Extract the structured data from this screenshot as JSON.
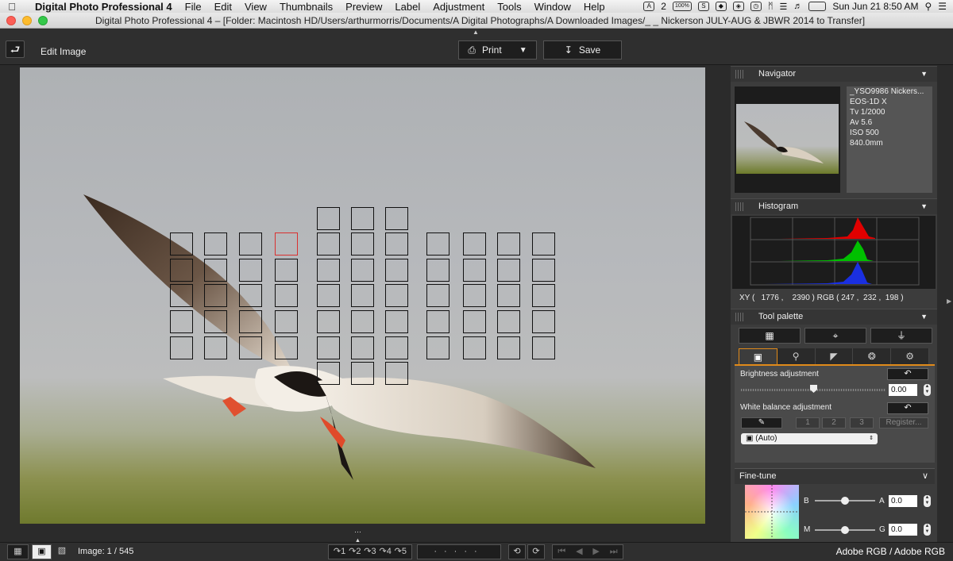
{
  "menubar": {
    "app_name": "Digital Photo Professional 4",
    "items": [
      "File",
      "Edit",
      "View",
      "Thumbnails",
      "Preview",
      "Label",
      "Adjustment",
      "Tools",
      "Window",
      "Help"
    ],
    "status_badge": "2",
    "percent": "100%",
    "clock": "Sun Jun 21  8:50 AM"
  },
  "titlebar": {
    "title": "Digital Photo Professional 4 – [Folder: Macintosh HD/Users/arthurmorris/Documents/A Digital Photographs/A Downloaded Images/_ _ Nickerson JULY-AUG & JBWR 2014 to Transfer]",
    "colors": {
      "close": "#fc5f57",
      "minimize": "#fdbc2e",
      "zoom": "#34c84a"
    }
  },
  "toolbar": {
    "mode_label": "Edit Image",
    "print_label": "Print",
    "save_label": "Save"
  },
  "navigator": {
    "header": "Navigator",
    "info": [
      "_YSO9986  Nickers...",
      "EOS-1D X",
      "Tv 1/2000",
      "Av 5.6",
      "ISO 500",
      "840.0mm"
    ]
  },
  "histogram": {
    "header": "Histogram",
    "xy_readout": "XY (   1776 ,    2390 ) RGB ( 247 ,  232 ,  198 )",
    "colors": {
      "red": "#e00000",
      "green": "#00c000",
      "blue": "#1a2fe0"
    }
  },
  "tool_palette": {
    "header": "Tool palette",
    "brightness_label": "Brightness adjustment",
    "brightness_value": "0.00",
    "brightness_level": 0.5,
    "wb_label": "White balance adjustment",
    "wb_buttons": [
      "1",
      "2",
      "3"
    ],
    "register_label": "Register...",
    "wb_mode": "(Auto)",
    "accent": "#e08a1a"
  },
  "finetune": {
    "header": "Fine-tune",
    "b_label": "B",
    "a_label": "A",
    "a_value": "0.0",
    "m_label": "M",
    "g_label": "G",
    "g_value": "0.0"
  },
  "bottombar": {
    "image_count": "Image: 1 / 545",
    "rotate_buttons": [
      "1",
      "2",
      "3",
      "4",
      "5"
    ],
    "color_profile": "Adobe RGB / Adobe RGB"
  }
}
